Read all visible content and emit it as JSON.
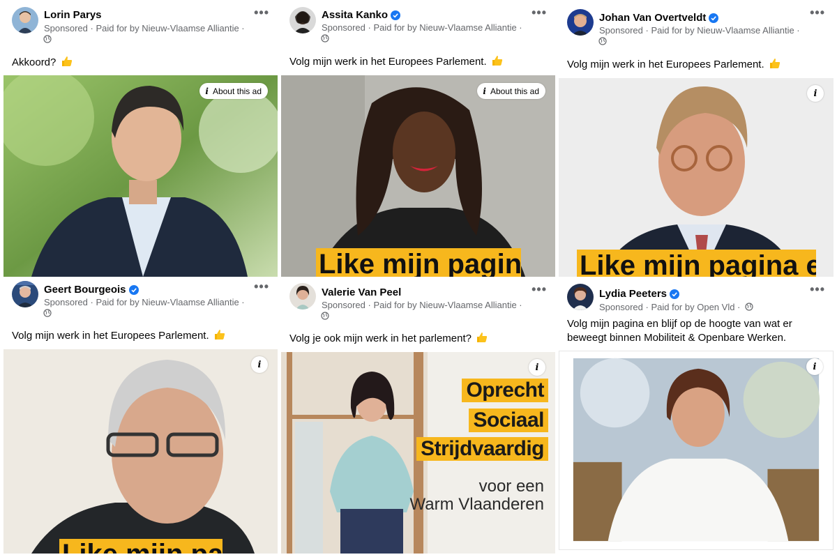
{
  "common": {
    "sponsored": "Sponsored",
    "paid_for": "Paid for by",
    "about_ad": "About this ad",
    "info_glyph": "i",
    "more_glyph": "•••"
  },
  "colors": {
    "banner_yellow": "#f7b71d",
    "verified_blue": "#1877f2",
    "meta_grey": "#65676b"
  },
  "ads": [
    {
      "name": "Lorin Parys",
      "verified": false,
      "payer": "Nieuw-Vlaamse Alliantie",
      "text": "Akkoord?",
      "emoji": "thumbs-up",
      "button": "about"
    },
    {
      "name": "Assita Kanko",
      "verified": true,
      "payer": "Nieuw-Vlaamse Alliantie",
      "text": "Volg mijn werk in het Europees Parlement.",
      "emoji": "thumbs-up",
      "button": "about",
      "banner": "Like mijn pagina"
    },
    {
      "name": "Johan Van Overtveldt",
      "verified": true,
      "payer": "Nieuw-Vlaamse Alliantie",
      "text": "Volg mijn werk in het Europees Parlement.",
      "emoji": "thumbs-up",
      "button": "info",
      "banner": "Like mijn pagina en"
    },
    {
      "name": "Geert Bourgeois",
      "verified": true,
      "payer": "Nieuw-Vlaamse Alliantie",
      "text": "Volg mijn werk in het Europees Parlement.",
      "emoji": "thumbs-up",
      "button": "info",
      "banner": "Like mijn pagina"
    },
    {
      "name": "Valerie Van Peel",
      "verified": false,
      "payer": "Nieuw-Vlaamse Alliantie",
      "text": "Volg je ook mijn werk in het parlement?",
      "emoji": "thumbs-up",
      "button": "info",
      "tags": [
        "Oprecht",
        "Sociaal",
        "Strijdvaardig"
      ],
      "slogan": [
        "voor een",
        "Warm Vlaanderen"
      ]
    },
    {
      "name": "Lydia Peeters",
      "verified": true,
      "payer": "Open Vld",
      "text_lines": [
        "Volg mijn pagina en blijf op de hoogte van wat er",
        "beweegt binnen Mobiliteit & Openbare Werken."
      ],
      "button": "info"
    }
  ]
}
